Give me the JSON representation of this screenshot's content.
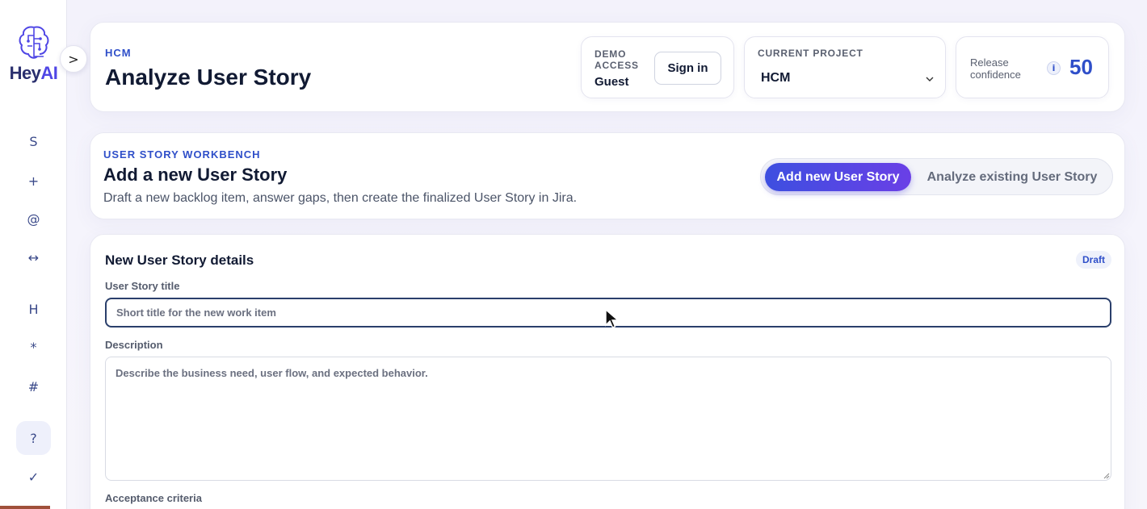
{
  "sidebar": {
    "logo": {
      "text_main": "Hey",
      "text_accent": "AI",
      "icon": "brain-circuit-icon"
    },
    "collapse_label": ">",
    "items": [
      {
        "glyph": "S",
        "name": "nav-s"
      },
      {
        "glyph": "+",
        "name": "nav-plus"
      },
      {
        "glyph": "@",
        "name": "nav-at"
      },
      {
        "glyph": "↔",
        "name": "nav-swap"
      },
      {
        "glyph": "H",
        "name": "nav-h"
      },
      {
        "glyph": "*",
        "name": "nav-star"
      },
      {
        "glyph": "#",
        "name": "nav-hash"
      },
      {
        "glyph": "?",
        "name": "nav-help"
      },
      {
        "glyph": "✓",
        "name": "nav-check"
      }
    ]
  },
  "header": {
    "eyebrow": "HCM",
    "title": "Analyze User Story",
    "demo": {
      "label": "DEMO ACCESS",
      "user": "Guest",
      "signin_label": "Sign in"
    },
    "project": {
      "label": "CURRENT PROJECT",
      "value": "HCM"
    },
    "confidence": {
      "label": "Release confidence",
      "info": "i",
      "value": "50"
    }
  },
  "workbench": {
    "eyebrow": "USER STORY WORKBENCH",
    "title": "Add a new User Story",
    "description": "Draft a new backlog item, answer gaps, then create the finalized User Story in Jira.",
    "toggle": {
      "active": "Add new User Story",
      "inactive": "Analyze existing User Story"
    }
  },
  "details": {
    "title": "New User Story details",
    "badge": "Draft",
    "title_field": {
      "label": "User Story title",
      "placeholder": "Short title for the new work item",
      "value": ""
    },
    "description_field": {
      "label": "Description",
      "placeholder": "Describe the business need, user flow, and expected behavior.",
      "value": ""
    },
    "acceptance_label": "Acceptance criteria"
  },
  "colors": {
    "accent": "#2f4fc9",
    "toggle_start": "#3d4fe0",
    "toggle_end": "#6a3fe6",
    "text": "#111a33"
  }
}
